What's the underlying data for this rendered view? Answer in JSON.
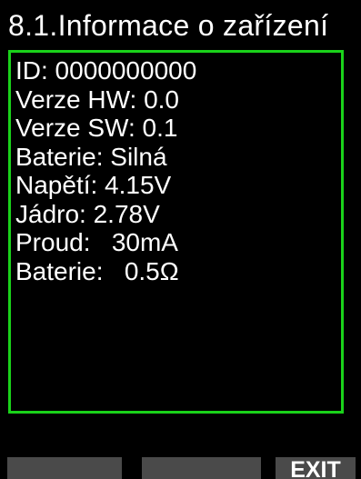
{
  "screen": {
    "title": "8.1.Informace o zařízení"
  },
  "info": {
    "rows": [
      "ID: 0000000000",
      "Verze HW: 0.0",
      "Verze SW: 0.1",
      "Baterie: Silná",
      "Napětí: 4.15V",
      "Jádro: 2.78V",
      "Proud:   30mA",
      "Baterie:   0.5Ω"
    ]
  },
  "softkeys": {
    "left": "",
    "center": "",
    "right": "EXIT"
  },
  "colors": {
    "background": "#000000",
    "text": "#ffffff",
    "panel_border": "#1ad21a",
    "softkey_bg": "#4a4a4a"
  }
}
